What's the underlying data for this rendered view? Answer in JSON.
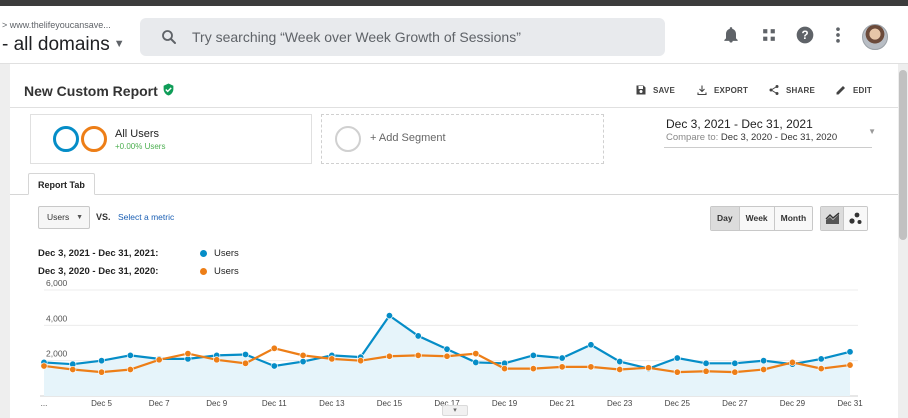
{
  "breadcrumb": "> www.thelifeyoucansave...",
  "domain_label": "- all domains",
  "search": {
    "placeholder": "Try searching “Week over Week Growth of Sessions”"
  },
  "report": {
    "title": "New Custom Report",
    "actions": [
      "SAVE",
      "EXPORT",
      "SHARE",
      "EDIT"
    ]
  },
  "segments": {
    "active": {
      "name": "All Users",
      "percent": "+0.00% Users"
    },
    "add_label": "+ Add Segment"
  },
  "date_range": {
    "primary": "Dec 3, 2021 - Dec 31, 2021",
    "compare_prefix": "Compare to:",
    "compare": "Dec 3, 2020 - Dec 31, 2020"
  },
  "tab": "Report Tab",
  "metric_select": {
    "value": "Users",
    "vs": "VS.",
    "select_metric": "Select a metric"
  },
  "granularity": [
    "Day",
    "Week",
    "Month"
  ],
  "granularity_selected": "Day",
  "legend": [
    {
      "dates": "Dec 3, 2021 - Dec 31, 2021:",
      "label": "Users",
      "color": "#058dc7"
    },
    {
      "dates": "Dec 3, 2020 - Dec 31, 2020:",
      "label": "Users",
      "color": "#ed7e17"
    }
  ],
  "colors": {
    "current": "#058dc7",
    "previous": "#ed7e17",
    "area": "#e6f4fa",
    "verified": "#0f9d58"
  },
  "chart_data": {
    "type": "line",
    "x": [
      "Dec 3",
      "Dec 4",
      "Dec 5",
      "Dec 6",
      "Dec 7",
      "Dec 8",
      "Dec 9",
      "Dec 10",
      "Dec 11",
      "Dec 12",
      "Dec 13",
      "Dec 14",
      "Dec 15",
      "Dec 16",
      "Dec 17",
      "Dec 18",
      "Dec 19",
      "Dec 20",
      "Dec 21",
      "Dec 22",
      "Dec 23",
      "Dec 24",
      "Dec 25",
      "Dec 26",
      "Dec 27",
      "Dec 28",
      "Dec 29",
      "Dec 30",
      "Dec 31"
    ],
    "x_tick_labels": [
      "...",
      "Dec 5",
      "Dec 7",
      "Dec 9",
      "Dec 11",
      "Dec 13",
      "Dec 15",
      "Dec 17",
      "Dec 19",
      "Dec 21",
      "Dec 23",
      "Dec 25",
      "Dec 27",
      "Dec 29",
      "Dec 31"
    ],
    "y_tick_labels": [
      "6,000",
      "4,000",
      "2,000"
    ],
    "ylim": [
      0,
      6000
    ],
    "series": [
      {
        "name": "Dec 3, 2021 - Dec 31, 2021: Users",
        "values": [
          1900,
          1800,
          2000,
          2300,
          2100,
          2100,
          2300,
          2350,
          1700,
          1950,
          2300,
          2200,
          4550,
          3400,
          2650,
          1900,
          1850,
          2300,
          2150,
          2900,
          1950,
          1550,
          2150,
          1850,
          1850,
          2000,
          1800,
          2100,
          2500
        ]
      },
      {
        "name": "Dec 3, 2020 - Dec 31, 2020: Users",
        "values": [
          1700,
          1500,
          1350,
          1500,
          2050,
          2400,
          2050,
          1850,
          2700,
          2300,
          2100,
          2000,
          2250,
          2300,
          2250,
          2400,
          1550,
          1550,
          1650,
          1650,
          1500,
          1600,
          1350,
          1400,
          1350,
          1500,
          1900,
          1550,
          1750
        ]
      }
    ]
  }
}
